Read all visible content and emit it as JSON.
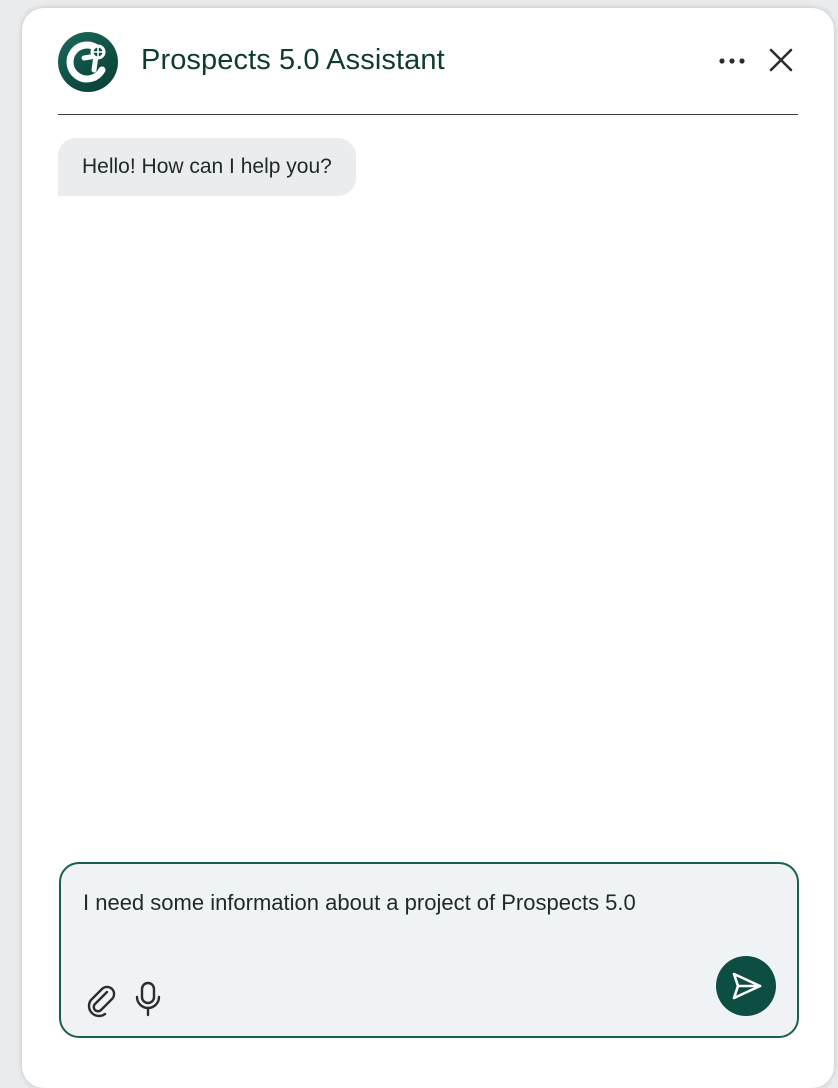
{
  "header": {
    "title": "Prospects 5.0 Assistant",
    "logo_icon": "assistant-logo-icon",
    "more_icon": "more-horizontal-icon",
    "close_icon": "close-icon"
  },
  "messages": [
    {
      "role": "assistant",
      "text": "Hello! How can I help you?"
    }
  ],
  "composer": {
    "value": "I need some information about a project of Prospects 5.0",
    "attach_icon": "paperclip-icon",
    "mic_icon": "microphone-icon",
    "send_icon": "send-icon"
  },
  "colors": {
    "brand": "#0e4d42",
    "title_text": "#0f3b33",
    "assistant_bubble": "#ebeced",
    "composer_bg": "#f0f3f6",
    "composer_border": "#1a5e52"
  }
}
